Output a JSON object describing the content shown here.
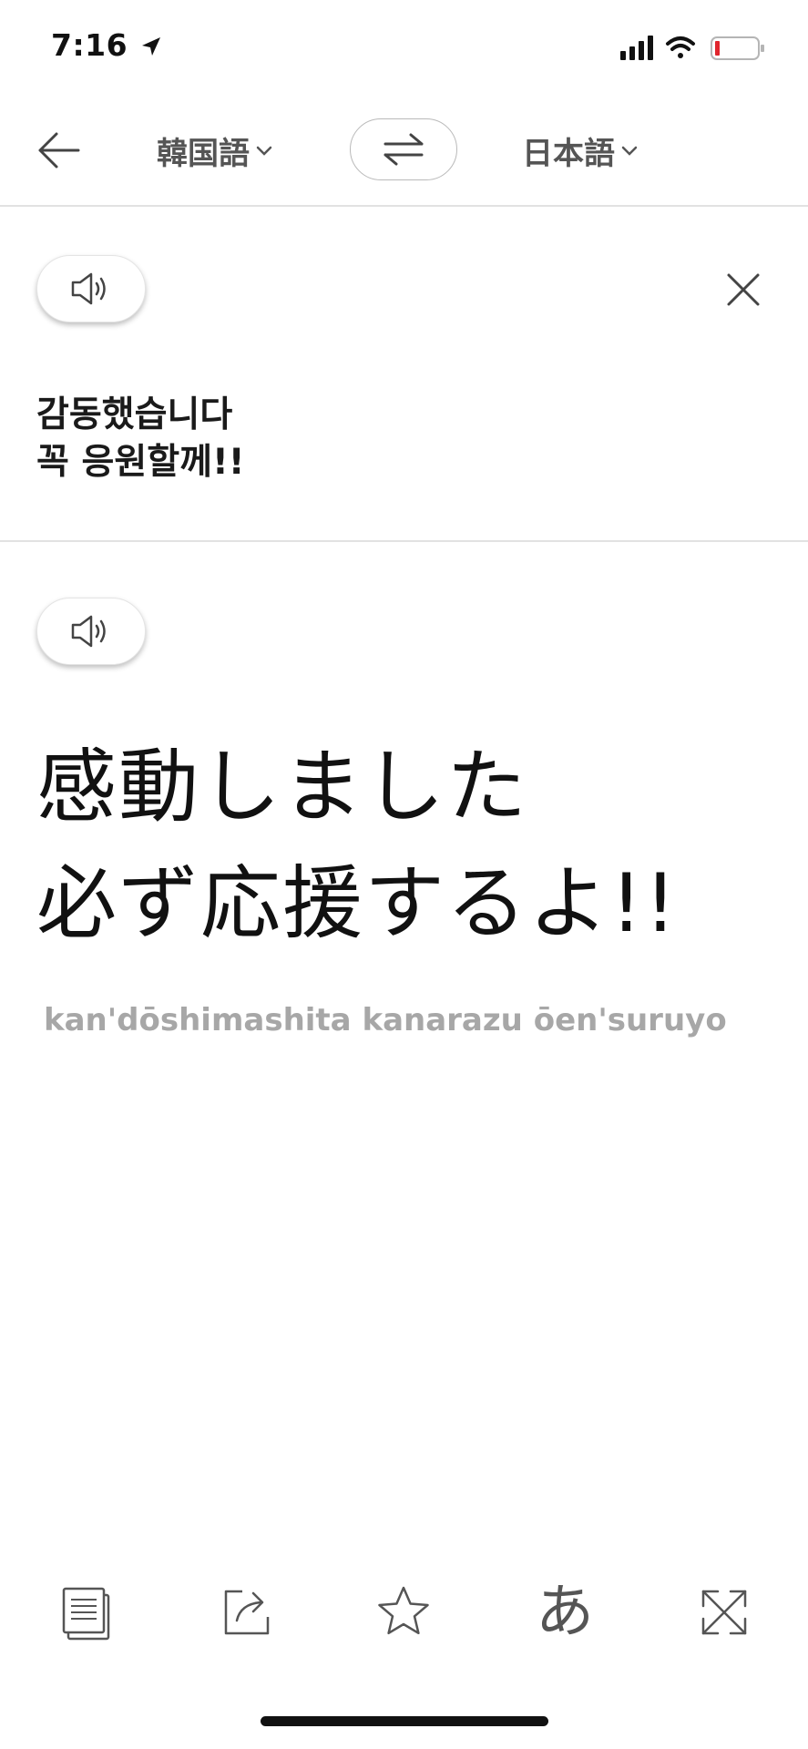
{
  "status_bar": {
    "time": "7:16"
  },
  "header": {
    "source_language": "韓国語",
    "target_language": "日本語"
  },
  "source": {
    "lines": [
      "감동했습니다",
      "꼭 응원할께!!"
    ]
  },
  "result": {
    "lines": [
      "感動しました",
      "必ず応援するよ!!"
    ],
    "romanization": "kan'dōshimashita kanarazu ōen'suruyo"
  },
  "toolbar": {
    "items": [
      {
        "icon": "copy-icon"
      },
      {
        "icon": "share-icon"
      },
      {
        "icon": "star-icon"
      },
      {
        "icon": "kana-icon",
        "label": "あ"
      },
      {
        "icon": "fullscreen-icon"
      }
    ]
  },
  "colors": {
    "text": "#111111",
    "muted": "#a7a7a7",
    "battery_low": "#e0262d"
  }
}
